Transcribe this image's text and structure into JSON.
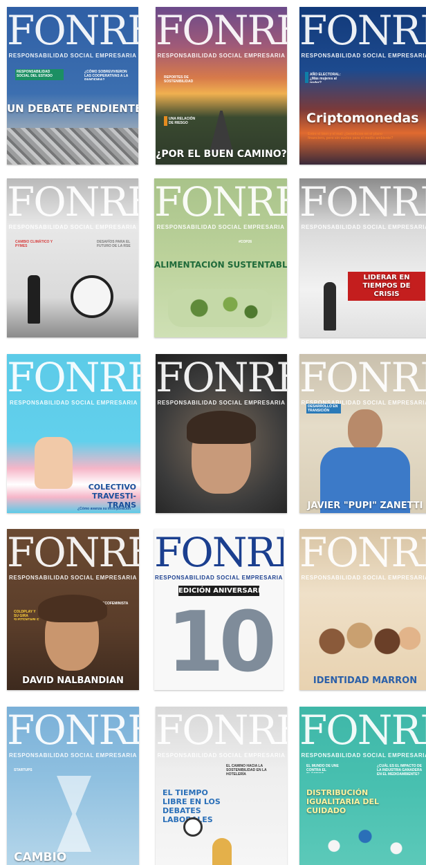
{
  "brand": {
    "logo": "FONRES",
    "tagline": "RESPONSABILIDAD SOCIAL EMPRESARIA"
  },
  "covers": [
    {
      "headline": "UN DEBATE PENDIENTE",
      "box_a": "RESPONSABILIDAD SOCIAL DEL ESTADO",
      "box_b": "¿CÓMO SOBREVIVIERON LAS COOPERATIVAS A LA PANDEMIA?"
    },
    {
      "headline": "¿POR EL BUEN CAMINO?",
      "box_a": "REPORTES DE SOSTENIBILIDAD",
      "box_b": "UNA RELACIÓN DE RIESGO"
    },
    {
      "headline": "Criptomonedas",
      "box_a": "AÑO ELECTORAL: ¿Más mujeres al poder?",
      "box_b": "Entre el bien y el mal: ¿beneficios en el plano financiero, pero sin vuelos para el medio ambiente?"
    },
    {
      "headline": "",
      "box_a": "CAMBIO CLIMÁTICO Y PYMES",
      "box_b": "DESAFÍOS PARA EL FUTURO DE LA RSE"
    },
    {
      "headline": "ALIMENTACIÓN SUSTENTABLE",
      "box_a": "#COP26",
      "box_b": ""
    },
    {
      "headline": "LIDERAR EN TIEMPOS DE CRISIS",
      "box_a": "",
      "box_b": ""
    },
    {
      "headline": "COLECTIVO TRAVESTI-TRANS",
      "box_a": "",
      "box_b": "¿Cómo avanza su incorporación"
    },
    {
      "headline": "",
      "box_a": "",
      "box_b": ""
    },
    {
      "headline": "JAVIER \"PUPI\" ZANETTI",
      "box_a": "DESARROLLO EN TRANSICIÓN",
      "box_b": ""
    },
    {
      "headline": "DAVID NALBANDIAN",
      "box_a": "COLDPLAY Y SU GIRA SUSTENTABLE",
      "box_b": "ECOFEMINISTA"
    },
    {
      "headline": "EDICIÓN ANIVERSARIO",
      "box_a": "10",
      "box_b": ""
    },
    {
      "headline": "IDENTIDAD MARRÓN",
      "box_a": "",
      "box_b": ""
    },
    {
      "headline": "CAMBIO",
      "box_a": "STARTUPS",
      "box_b": ""
    },
    {
      "headline": "EL TIEMPO LIBRE EN LOS DEBATES LABORALES",
      "box_a": "",
      "box_b": "EL CAMINO HACIA LA SOSTENIBILIDAD EN LA HOTELERÍA"
    },
    {
      "headline": "DISTRIBUCIÓN IGUALITARIA DEL CUIDADO",
      "box_a": "EL MUNDO DE UNE CONTRA EL PLÁSTICO",
      "box_b": "¿CUÁL ES EL IMPACTO DE LA INDUSTRIA GANADERA EN EL MEDIOAMBIENTE?"
    }
  ]
}
